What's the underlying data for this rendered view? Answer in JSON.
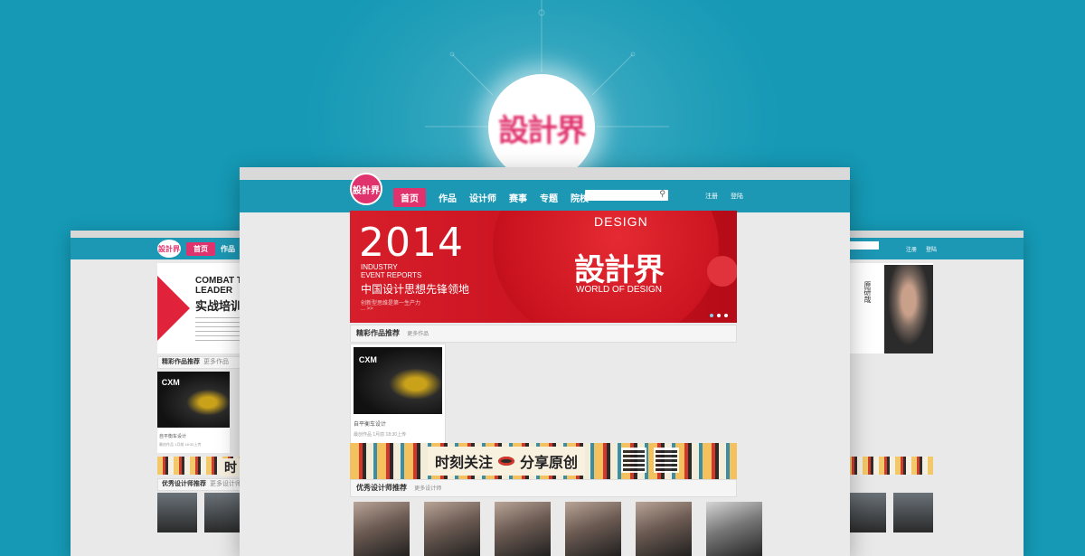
{
  "hero": {
    "logo_text": "設計界"
  },
  "main": {
    "logo_text": "設計界",
    "nav": {
      "items": [
        "首页",
        "作品",
        "设计师",
        "赛事",
        "专题",
        "院校"
      ],
      "search_placeholder": "",
      "auth": [
        "注册",
        "登陆"
      ]
    },
    "banner": {
      "year": "2014",
      "reports_line1": "INDUSTRY",
      "reports_line2": "EVENT REPORTS",
      "headline_cn": "中国设计思想先锋领地",
      "subline_cn": "创新型思维是第一生产力",
      "more": "... >>",
      "design_word": "DESIGN",
      "brand": "設計界",
      "tagline": "WORLD OF DESIGN"
    },
    "works_section": {
      "title": "精彩作品推荐",
      "more": "更多作品"
    },
    "work_card": {
      "title": "自平衡车设计",
      "meta": "最创作品 1月前 18:30上传",
      "img_label": "CXM"
    },
    "ad_strip": {
      "text_left": "时刻关注",
      "text_right": "分享原创"
    },
    "designers_section": {
      "title": "优秀设计师推荐",
      "more": "更多设计师"
    }
  },
  "left_window": {
    "nav": {
      "active": "首页",
      "item": "作品",
      "logo": "設計界"
    },
    "banner": {
      "line1": "COMBAT T",
      "line2": "LEADER",
      "line3": "实战培训"
    },
    "works_section": {
      "title": "精彩作品推荐",
      "more": "更多作品"
    },
    "work": {
      "title": "自平衡车设计",
      "meta": "最创作品 1月前 18:30上传"
    },
    "ad_text": "时",
    "designers_section": {
      "title": "优秀设计师推荐",
      "more": "更多设计师"
    }
  },
  "right_window": {
    "auth": [
      "注册",
      "登陆"
    ],
    "photo_name": "原研哉"
  }
}
